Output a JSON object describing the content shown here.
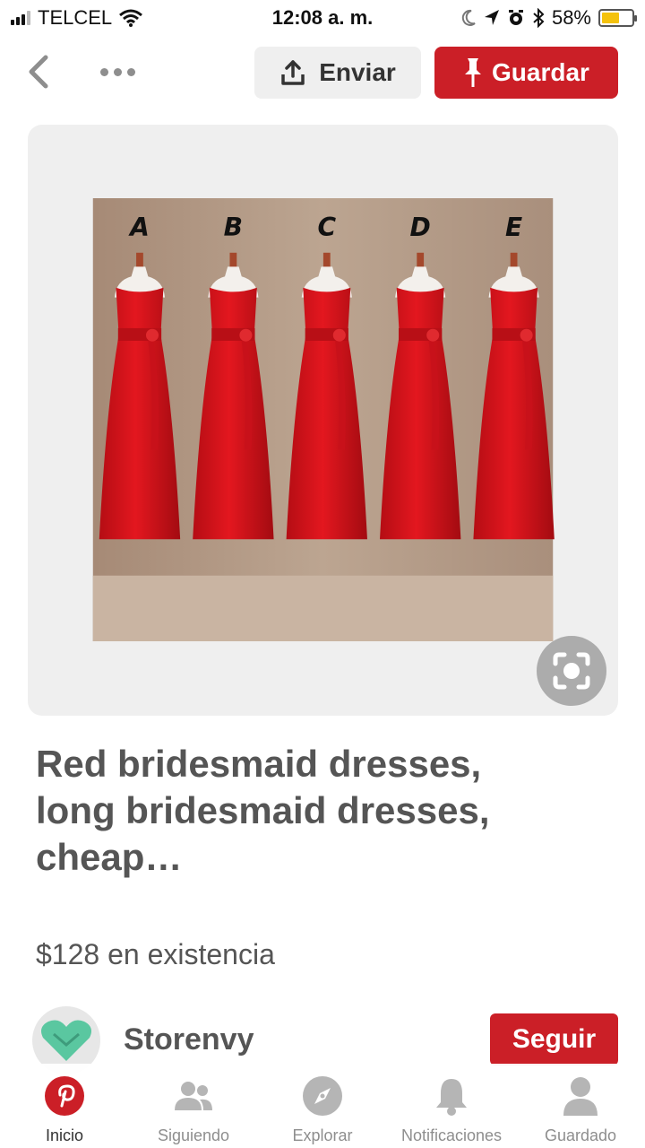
{
  "status_bar": {
    "carrier": "TELCEL",
    "time": "12:08 a. m.",
    "battery_percent": "58%",
    "battery_level": 0.58,
    "icons": [
      "signal-icon",
      "wifi-icon",
      "moon-icon",
      "location-icon",
      "alarm-icon",
      "bluetooth-icon",
      "battery-icon"
    ]
  },
  "toolbar": {
    "send_label": "Enviar",
    "save_label": "Guardar"
  },
  "pin": {
    "image_letters": [
      "A",
      "B",
      "C",
      "D",
      "E"
    ],
    "title": "Red bridesmaid dresses, long bridesmaid dresses, cheap…",
    "price": "$128 en existencia"
  },
  "store": {
    "name": "Storenvy",
    "follow_label": "Seguir"
  },
  "nav": {
    "items": [
      {
        "label": "Inicio",
        "icon": "pinterest-icon",
        "active": true
      },
      {
        "label": "Siguiendo",
        "icon": "people-icon",
        "active": false
      },
      {
        "label": "Explorar",
        "icon": "compass-icon",
        "active": false
      },
      {
        "label": "Notificaciones",
        "icon": "bell-icon",
        "active": false
      },
      {
        "label": "Guardado",
        "icon": "profile-icon",
        "active": false
      }
    ]
  },
  "colors": {
    "accent": "#cb1f27",
    "dress_red": "#d4121a",
    "background_wall": "#b49b86",
    "store_logo": "#5ac7a0"
  }
}
